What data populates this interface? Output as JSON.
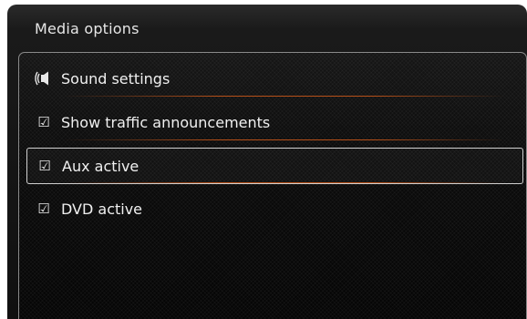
{
  "header": {
    "title": "Media options"
  },
  "menu": {
    "items": [
      {
        "label": "Sound settings",
        "icon": "speaker-icon"
      },
      {
        "label": "Show traffic announcements",
        "icon": "checkbox-checked-icon",
        "checked": true
      },
      {
        "label": "Aux active",
        "icon": "checkbox-checked-icon",
        "checked": true,
        "selected": true
      },
      {
        "label": "DVD active",
        "icon": "checkbox-checked-icon",
        "checked": true
      }
    ]
  },
  "colors": {
    "accent_separator": "#d25a19",
    "selection_border": "#d0d0d0",
    "background": "#0a0a0a"
  }
}
